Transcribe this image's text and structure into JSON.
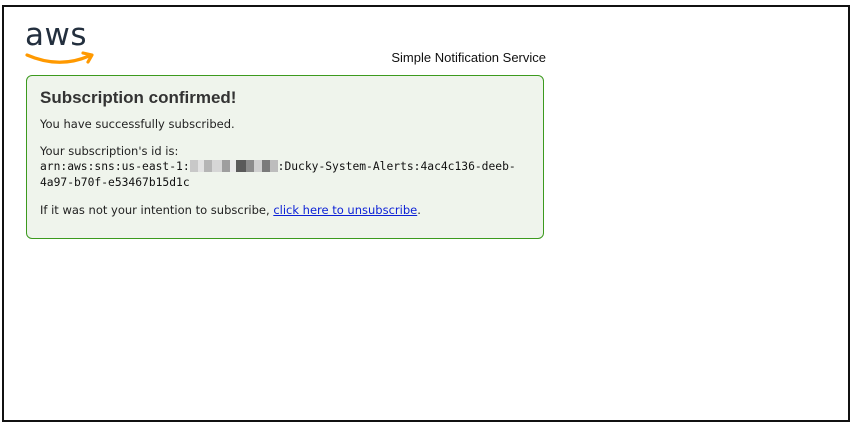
{
  "logo": {
    "text": "aws",
    "accent_color": "#ff9900",
    "text_color": "#232f3e"
  },
  "header": {
    "service_name": "Simple Notification Service"
  },
  "panel": {
    "title": "Subscription confirmed!",
    "message": "You have successfully subscribed.",
    "id_label": "Your subscription's id is:",
    "arn_prefix": "arn:aws:sns:us-east-1:",
    "arn_suffix": ":Ducky-System-Alerts:4ac4c136-deeb-4a97-b70f-e53467b15d1c",
    "unsubscribe_prefix": "If it was not your intention to subscribe, ",
    "unsubscribe_link": "click here to unsubscribe",
    "unsubscribe_suffix": ".",
    "border_color": "#3c9a1e",
    "background_color": "#eff4ec",
    "link_color": "#0a1fd6"
  }
}
